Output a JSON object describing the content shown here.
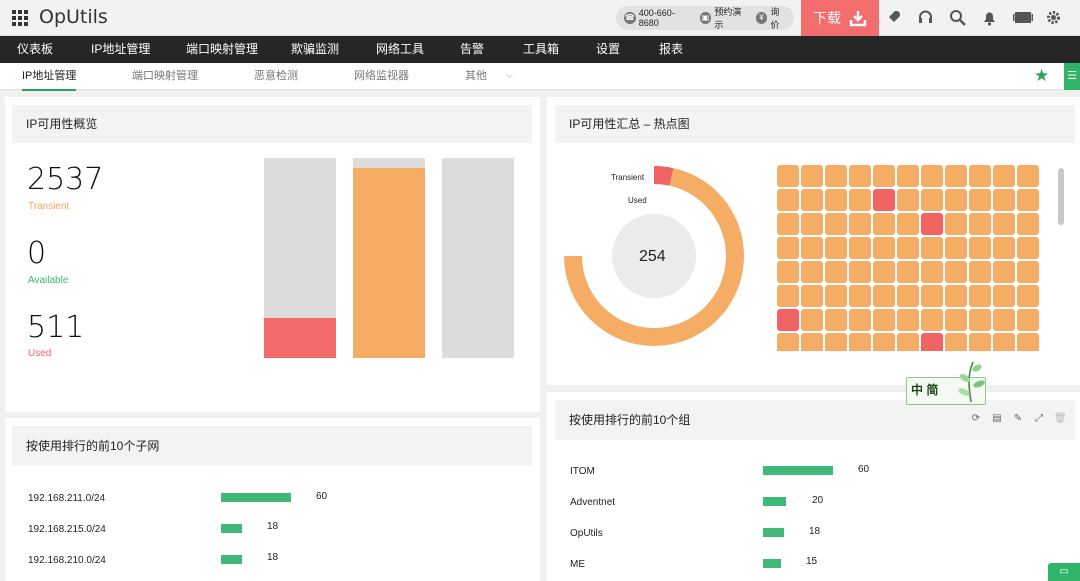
{
  "app": {
    "title": "OpUtils",
    "phone": "400-660-8680",
    "demo_label": "预约演示",
    "quote_label": "询价",
    "download_label": "下载"
  },
  "mainnav": [
    {
      "label": "仪表板"
    },
    {
      "label": "IP地址管理"
    },
    {
      "label": "端口映射管理"
    },
    {
      "label": "欺骗监测"
    },
    {
      "label": "网络工具"
    },
    {
      "label": "告警"
    },
    {
      "label": "工具箱"
    },
    {
      "label": "设置"
    },
    {
      "label": "报表"
    }
  ],
  "subtabs": [
    {
      "label": "IP地址管理",
      "active": true
    },
    {
      "label": "端口映射管理"
    },
    {
      "label": "恶意检测"
    },
    {
      "label": "网络监视器"
    },
    {
      "label": "其他"
    }
  ],
  "overview": {
    "title": "IP可用性概览",
    "stats": [
      {
        "value": "2537",
        "label": "Transient",
        "color": "#f5a65b"
      },
      {
        "value": "0",
        "label": "Available",
        "color": "#3fb878"
      },
      {
        "value": "511",
        "label": "Used",
        "color": "#f06464"
      }
    ],
    "bars": [
      {
        "fill_fraction": 0.2,
        "color": "#f26b6b"
      },
      {
        "fill_fraction": 0.95,
        "color": "#f5ad66"
      },
      {
        "fill_fraction": 0.0,
        "color": "#f5ad66"
      }
    ]
  },
  "heatmap": {
    "title": "IP可用性汇总 – 热点图",
    "center_value": "254",
    "legend_transient": "Transient",
    "legend_used": "Used",
    "donut": {
      "transient_fraction": 0.965,
      "used_fraction": 0.035,
      "transient_color": "#f5ad66",
      "used_color": "#f06464"
    },
    "cols": 11,
    "rows": 8,
    "used_cells": [
      [
        1,
        4
      ],
      [
        2,
        6
      ],
      [
        6,
        0
      ],
      [
        7,
        6
      ]
    ],
    "cell_color": "#f5ad66",
    "used_color": "#f06464"
  },
  "subnets": {
    "title": "按使用排行的前10个子网",
    "rows": [
      {
        "label": "192.168.211.0/24",
        "value": 60
      },
      {
        "label": "192.168.215.0/24",
        "value": 18
      },
      {
        "label": "192.168.210.0/24",
        "value": 18
      }
    ]
  },
  "groups": {
    "title": "按使用排行的前10个组",
    "rows": [
      {
        "label": "ITOM",
        "value": 60
      },
      {
        "label": "Adventnet",
        "value": 20
      },
      {
        "label": "OpUtils",
        "value": 18
      },
      {
        "label": "ME",
        "value": 15
      }
    ]
  },
  "ime": {
    "label": "中 简"
  },
  "icons": {
    "apps": "grid-icon",
    "rocket": "rocket-icon",
    "headset": "headset-icon",
    "search": "search-icon",
    "bell": "bell-icon",
    "battery": "film-icon",
    "gear": "gear-icon",
    "star": "star-icon"
  }
}
